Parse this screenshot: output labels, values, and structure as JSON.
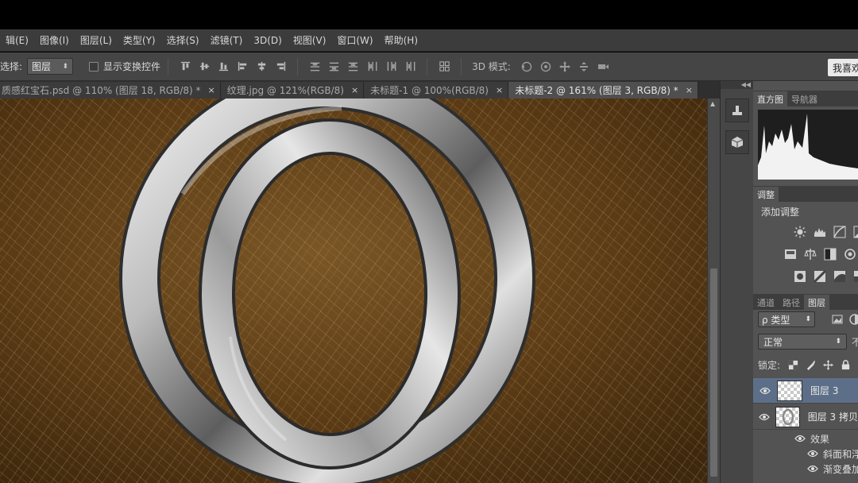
{
  "menu": [
    "辑(E)",
    "图像(I)",
    "图层(L)",
    "类型(Y)",
    "选择(S)",
    "滤镜(T)",
    "3D(D)",
    "视图(V)",
    "窗口(W)",
    "帮助(H)"
  ],
  "options": {
    "select_label": "选择:",
    "select_value": "图层",
    "show_transform": "显示变换控件",
    "mode_3d_label": "3D 模式:",
    "workspace_button": "我喜欢"
  },
  "tabs": [
    {
      "label": "质感红宝石.psd @ 110% (图层 18, RGB/8) *",
      "close": "×"
    },
    {
      "label": "纹理.jpg @ 121%(RGB/8)",
      "close": "×"
    },
    {
      "label": "未标题-1 @ 100%(RGB/8)",
      "close": "×"
    },
    {
      "label": "未标题-2 @ 161% (图层 3, RGB/8) *",
      "close": "×"
    }
  ],
  "panels": {
    "histogram_tab": "直方图",
    "navigator_tab": "导航器",
    "adjust_tab": "调整",
    "add_adjustment": "添加调整",
    "channels_tab": "通道",
    "paths_tab": "路径",
    "layers_tab": "图层",
    "layer_filter": "ρ 类型",
    "blend_mode": "正常",
    "opacity_cut": "不",
    "lock_label": "锁定:",
    "layers": [
      {
        "name": "图层 3"
      },
      {
        "name": "图层 3 拷贝"
      }
    ],
    "effects_label": "效果",
    "effect_items": [
      "斜面和浮雕",
      "渐变叠加"
    ]
  },
  "colors": {
    "canvas_brown": "#5a3b17",
    "selected_layer": "#5d6f88",
    "panel_bg": "#535353"
  }
}
